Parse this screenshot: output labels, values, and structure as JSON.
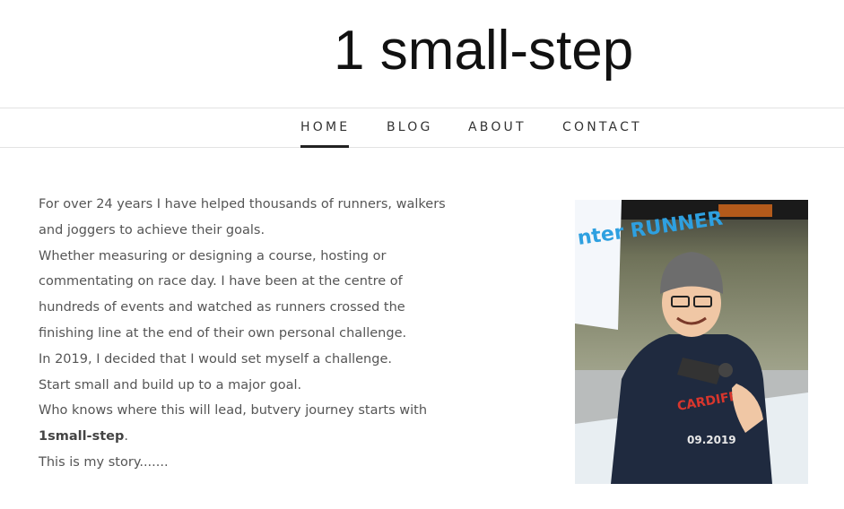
{
  "site": {
    "title": "1 small-step"
  },
  "nav": {
    "items": [
      {
        "label": "HOME",
        "active": true
      },
      {
        "label": "BLOG",
        "active": false
      },
      {
        "label": "ABOUT",
        "active": false
      },
      {
        "label": "CONTACT",
        "active": false
      }
    ]
  },
  "main": {
    "paragraphs": [
      "For over 24 years I have helped thousands of runners, walkers and joggers to achieve their goals.",
      "Whether measuring or designing a course, hosting or commentating on race day. I have been at the centre of hundreds of events and watched as runners crossed the finishing line at the end of their own personal challenge.",
      "In 2019, I decided that I would set myself a challenge.",
      "Start small and build up to a major goal."
    ],
    "line_journey_prefix": "Who knows where this will lead, butvery journey starts with ",
    "line_journey_bold": "1small-step",
    "line_journey_suffix": ".",
    "closing": "This is my story......."
  },
  "photo": {
    "banner_text": "nter RUNNER",
    "shirt_text": "CARDIFF",
    "date_text": "09.2019",
    "colors": {
      "background": "#7d8468",
      "hoodie": "#1f2a3f",
      "banner": "#f4f7fb",
      "accent": "#d8362d"
    }
  }
}
